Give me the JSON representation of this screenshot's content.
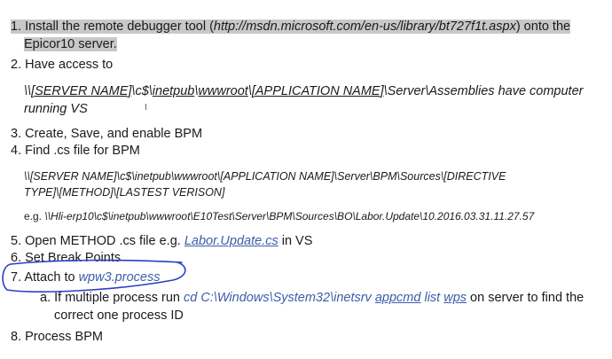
{
  "steps": {
    "s1": {
      "a": "1. Install the remote debugger tool (",
      "url": "http://msdn.microsoft.com/en-us/library/bt727f1t.aspx",
      "b": ") onto the",
      "c": "Epicor10 server."
    },
    "s2": {
      "label": "2. Have access to",
      "p1": "\\\\",
      "server": "[SERVER NAME]",
      "p2": "\\c$\\",
      "inetpub": "inetpub",
      "p3": "\\",
      "wwwroot": "wwwroot",
      "p4": "\\",
      "app": "[APPLICATION NAME]",
      "p5": "\\Server\\Assemblies have computer",
      "line2": "running VS"
    },
    "s3": "3. Create, Save, and enable BPM",
    "s4": {
      "label": "4. Find .cs file for BPM",
      "path1": "\\\\[SERVER NAME]\\c$\\inetpub\\wwwroot\\[APPLICATION NAME]\\Server\\BPM\\Sources\\[DIRECTIVE",
      "path2": "TYPE]\\[METHOD]\\[LASTEST VERISON]",
      "eg_label": "e.g. ",
      "eg_path": "\\\\Hli-erp10\\c$\\inetpub\\wwwroot\\E10Test\\Server\\BPM\\Sources\\BO\\Labor.Update\\10.2016.03.31.11.27.57"
    },
    "s5": {
      "a": "5. Open METHOD .cs file e.g. ",
      "file": "Labor.Update.cs",
      "b": " in VS"
    },
    "s6": "6. Set Break Points",
    "s7": {
      "a": "7. Attach to ",
      "proc": "wpw3.process"
    },
    "s7a": {
      "a": "a.  If multiple process run ",
      "cd": "cd C:\\Windows\\System32\\inetsrv",
      "sp1": " ",
      "appcmd": "appcmd",
      "sp2": " ",
      "list": "list",
      "sp3": " ",
      "wps": "wps",
      "b": " on server to find the",
      "line2": "correct one process ID"
    },
    "s8": "8. Process BPM",
    "colors": {
      "highlight": "#c8c8c8",
      "link": "#3b5ea8",
      "annotation_circle": "#2a3fc4"
    }
  }
}
